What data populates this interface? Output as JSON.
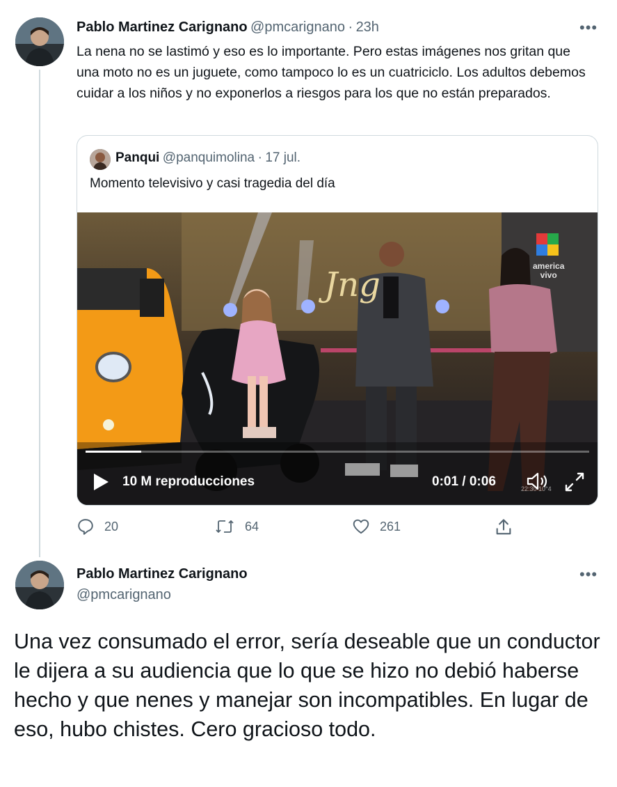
{
  "tweet1": {
    "author_name": "Pablo Martinez Carignano",
    "handle": "@pmcarignano",
    "separator": "·",
    "time": "23h",
    "text": "La nena no se lastimó y eso es lo importante. Pero estas imágenes nos gritan que una moto no es un juguete, como tampoco lo es un cuatriciclo. Los adultos debemos cuidar a los niños y no exponerlos a riesgos para los que no están preparados.",
    "more_label": "•••"
  },
  "quote": {
    "author_name": "Panqui",
    "handle": "@panquimolina",
    "separator": "·",
    "time": "17 jul.",
    "text": "Momento televisivo y casi tragedia del día",
    "video": {
      "views": "10 M reproducciones",
      "time": "0:01 / 0:06",
      "progress": 0.11,
      "channel_label_1": "america",
      "channel_label_2": "vivo",
      "show_logo": "Jng",
      "clock_overlay": "22:30 10°4"
    }
  },
  "actions": {
    "reply_count": "20",
    "retweet_count": "64",
    "like_count": "261"
  },
  "tweet2": {
    "author_name": "Pablo Martinez Carignano",
    "handle": "@pmcarignano",
    "text": "Una vez consumado el error, sería deseable que un conductor le dijera a su audiencia que lo que se hizo no debió haberse hecho y que nenes y manejar son incompatibles. En lugar de eso, hubo chistes. Cero gracioso todo.",
    "more_label": "•••"
  },
  "colors": {
    "secondary_text": "#536471",
    "border": "#cfd9de",
    "car_orange": "#f39a16"
  }
}
